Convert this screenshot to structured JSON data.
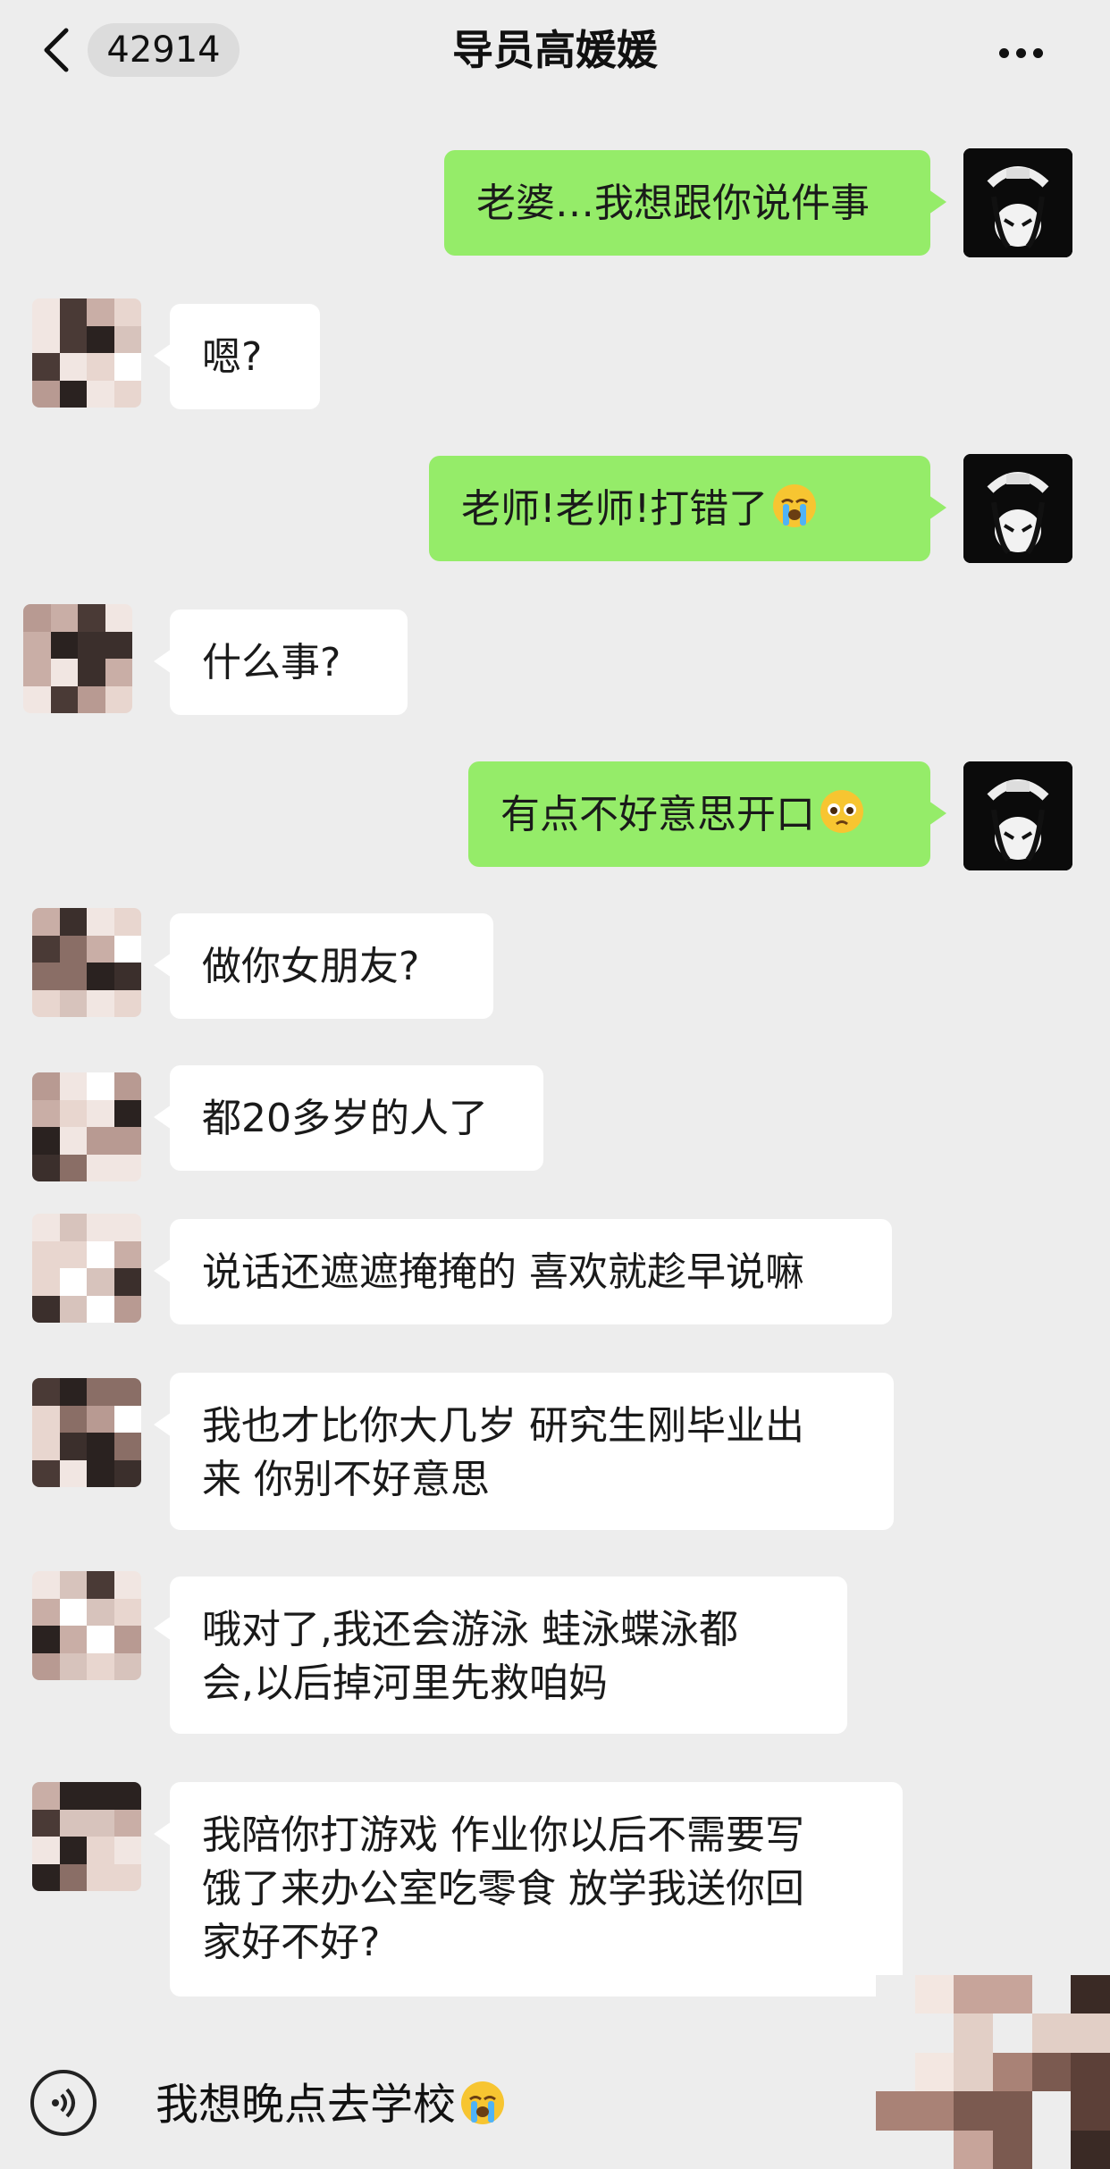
{
  "header": {
    "back_icon": "chevron-left-icon",
    "unread_count": "42914",
    "title": "导员高媛媛",
    "more_icon": "ellipsis-icon"
  },
  "messages": [
    {
      "side": "me",
      "text": "老婆…我想跟你说件事",
      "emoji": ""
    },
    {
      "side": "other",
      "text": "嗯?",
      "emoji": ""
    },
    {
      "side": "me",
      "text": "老师!老师!打错了",
      "emoji": "loudly-crying-face"
    },
    {
      "side": "other",
      "text": "什么事?",
      "emoji": ""
    },
    {
      "side": "me",
      "text": "有点不好意思开口",
      "emoji": "pleading-face"
    },
    {
      "side": "other",
      "text": "做你女朋友?",
      "emoji": ""
    },
    {
      "side": "other",
      "text": "都20多岁的人了",
      "emoji": ""
    },
    {
      "side": "other",
      "text": "说话还遮遮掩掩的 喜欢就趁早说嘛",
      "emoji": ""
    },
    {
      "side": "other",
      "text": "我也才比你大几岁 研究生刚毕业出\n来 你别不好意思",
      "emoji": ""
    },
    {
      "side": "other",
      "text": "哦对了,我还会游泳 蛙泳蝶泳都\n会,以后掉河里先救咱妈",
      "emoji": ""
    },
    {
      "side": "other",
      "text": "我陪你打游戏 作业你以后不需要写\n饿了来办公室吃零食 放学我送你回\n家好不好?",
      "emoji": ""
    }
  ],
  "footer": {
    "voice_icon": "voice-input-icon",
    "input_text": "我想晚点去学校",
    "input_emoji": "loudly-crying-face"
  },
  "colors": {
    "background": "#ededed",
    "my_bubble": "#95ec69",
    "other_bubble": "#ffffff"
  }
}
